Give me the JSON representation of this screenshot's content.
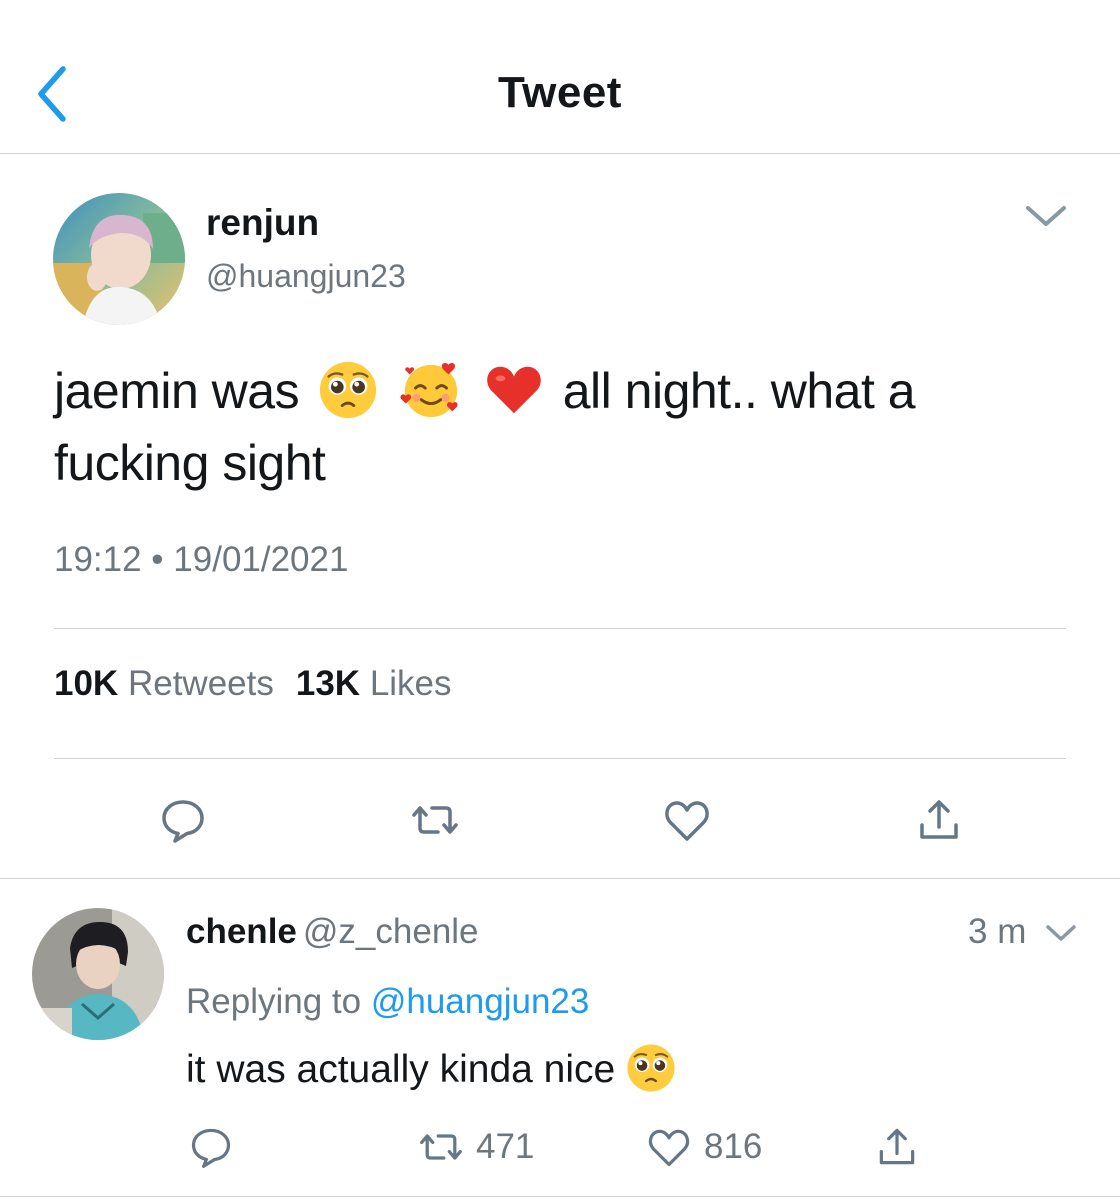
{
  "header": {
    "title": "Tweet",
    "back_icon": "chevron-left-icon"
  },
  "tweet": {
    "author_name": "renjun",
    "author_handle": "@huangjun23",
    "text_before": "jaemin was",
    "emojis": [
      "pleading-face-emoji",
      "smiling-face-with-hearts-emoji",
      "red-heart-emoji"
    ],
    "text_after": "all night.. what a fucking sight",
    "timestamp": "19:12 • 19/01/2021",
    "retweets_count": "10K",
    "retweets_label": "Retweets",
    "likes_count": "13K",
    "likes_label": "Likes",
    "actions": [
      "reply-icon",
      "retweet-icon",
      "like-icon",
      "share-icon"
    ]
  },
  "reply": {
    "author_name": "chenle",
    "author_handle": "@z_chenle",
    "time": "3 m",
    "replying_prefix": "Replying to",
    "replying_handle": "@huangjun23",
    "text": "it was actually kinda nice",
    "emoji": "pleading-face-emoji",
    "retweets": "471",
    "likes": "816"
  },
  "colors": {
    "link": "#1d9bf0",
    "secondary_text": "#6e767d",
    "primary_text": "#14171a",
    "divider": "#cfd3d6"
  }
}
